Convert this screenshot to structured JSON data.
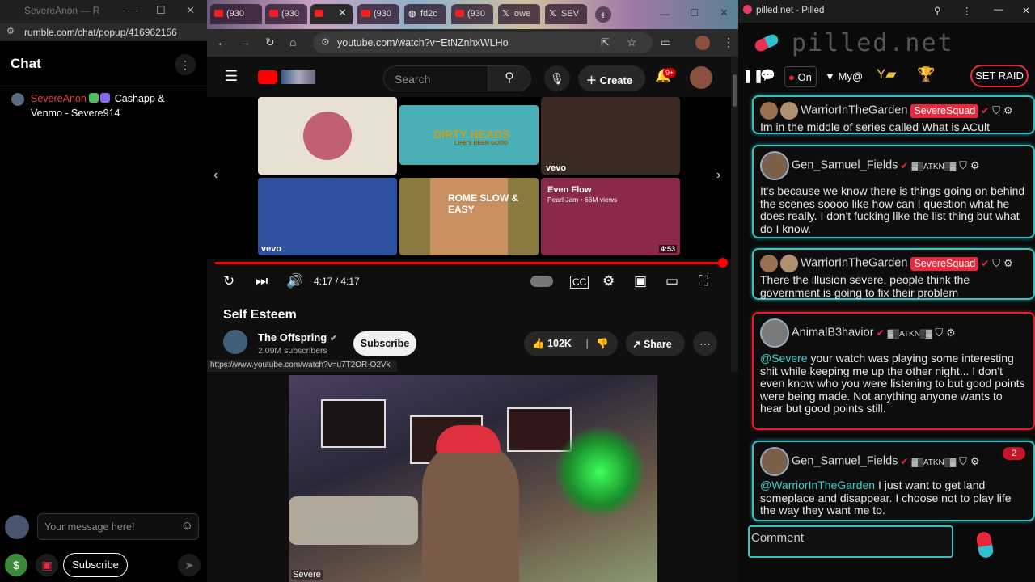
{
  "rumble": {
    "tab_title": "SevereAnon — R",
    "url": "rumble.com/chat/popup/416962156",
    "chat_title": "Chat",
    "message": {
      "username": "SevereAnon",
      "text": "Cashapp & Venmo - Severe914"
    },
    "input_placeholder": "Your message here!",
    "subscribe_label": "Subscribe"
  },
  "chrome": {
    "tabs": [
      "(930",
      "(930",
      "",
      "(930",
      "fd2c",
      "(930",
      "owe",
      "SEV"
    ],
    "url": "youtube.com/watch?v=EtNZnhxWLHo"
  },
  "youtube": {
    "search_placeholder": "Search",
    "create_label": "Create",
    "notif_count": "9+",
    "end_screen": [
      {
        "title": "",
        "label": ""
      },
      {
        "title": "DIRTY HEADS",
        "label": "LIFE'S BEEN GOOD"
      },
      {
        "title": "",
        "label": "vevo"
      },
      {
        "title": "",
        "label": "vevo"
      },
      {
        "title": "ROME SLOW & EASY",
        "label": ""
      },
      {
        "title": "Even Flow",
        "label": "Pearl Jam • 66M views",
        "duration": "4:53"
      }
    ],
    "time": "4:17 / 4:17",
    "video_title": "Self Esteem",
    "channel": "The Offspring",
    "subscribers": "2.09M subscribers",
    "subscribe_label": "Subscribe",
    "likes": "102K",
    "share_label": "Share",
    "status_url": "https://www.youtube.com/watch?v=u7T2OR-O2Vk",
    "webcam_label": "Severe"
  },
  "pilled": {
    "window_title": "pilled.net - Pilled",
    "brand": "pilled.net",
    "nav": {
      "on": "On",
      "myat": "My@",
      "raid": "SET RAID"
    },
    "messages": [
      {
        "user": "WarriorInTheGarden",
        "squad": "SevereSquad",
        "text": "Im in the middle of series called What is ACult"
      },
      {
        "user": "Gen_Samuel_Fields",
        "text": "It's because we know there is things going on behind the scenes soooo like how can I question what he does really. I don't fucking like the list thing but what do I know."
      },
      {
        "user": "WarriorInTheGarden",
        "squad": "SevereSquad",
        "text": "There the illusion severe, people think the government is going to fix their problem"
      },
      {
        "user": "AnimalB3havior",
        "mention": "@Severe",
        "text": " your watch was playing some interesting shit while keeping me up the other night... I don't even know who you were listening to but good points were being made. Not anything anyone wants to hear but good points still."
      },
      {
        "user": "Gen_Samuel_Fields",
        "mention": "@WarriorInTheGarden",
        "text": " I just want to get land someplace and disappear. I choose not to play life the way they want me to.",
        "badge": "2"
      }
    ],
    "comment_placeholder": "Comment"
  }
}
